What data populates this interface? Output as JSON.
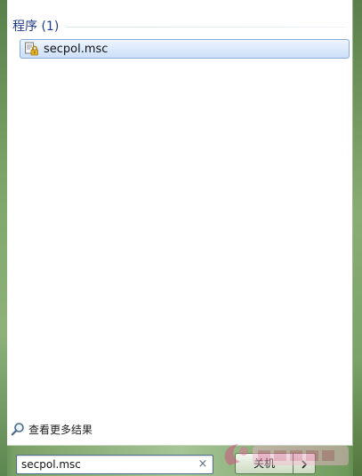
{
  "results": {
    "section_title": "程序 (1)",
    "items": [
      {
        "label": "secpol.msc",
        "icon": "security-policy-icon"
      }
    ]
  },
  "see_more": {
    "label": "查看更多结果",
    "icon": "search-magnifier-icon"
  },
  "search": {
    "value": "secpol.msc",
    "clear_glyph": "×"
  },
  "shutdown": {
    "label": "关机",
    "arrow_icon": "chevron-right-icon"
  },
  "colors": {
    "section_title": "#1e3a8a",
    "selection_border": "#84acdd",
    "desktop": "#a6c596"
  }
}
